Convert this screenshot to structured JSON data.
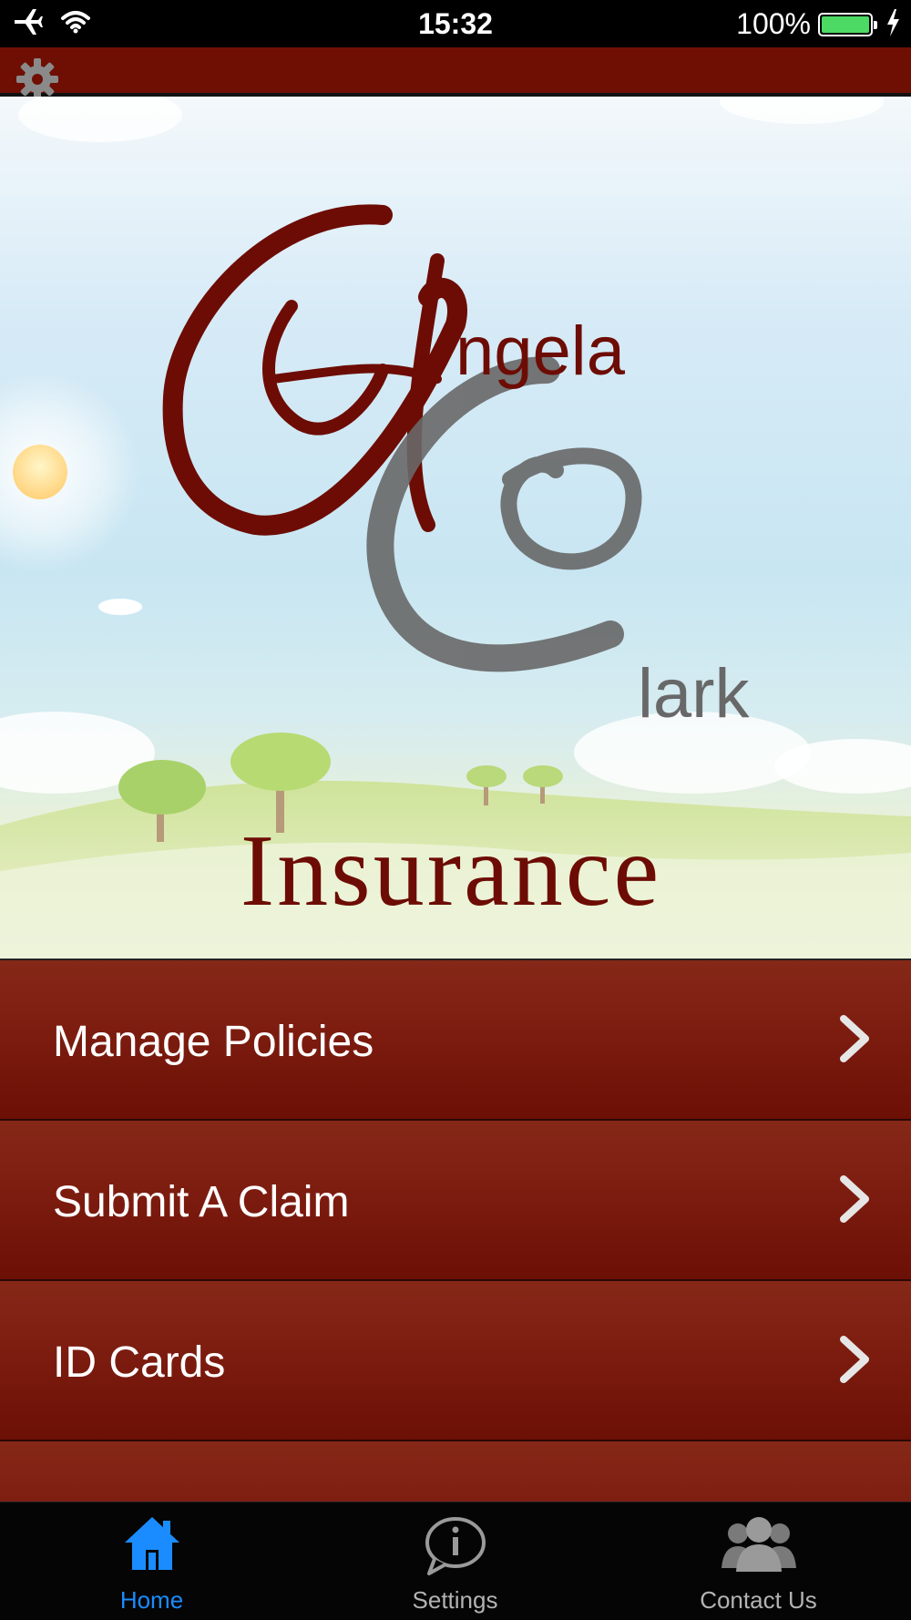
{
  "status_bar": {
    "time": "15:32",
    "battery_percent": "100%",
    "icons": [
      "airplane-icon",
      "wifi-icon",
      "battery-icon",
      "charging-bolt-icon"
    ]
  },
  "header": {
    "icon": "gear-icon",
    "color": "#6f0f04"
  },
  "hero": {
    "logo": {
      "line1": "ngela",
      "line2": "lark",
      "line3": "Insurance"
    },
    "colors": {
      "brand_red": "#6d0c04",
      "brand_gray": "#686868"
    }
  },
  "menu": {
    "items": [
      {
        "label": "Manage Policies",
        "icon": "chevron-right-icon"
      },
      {
        "label": "Submit A Claim",
        "icon": "chevron-right-icon"
      },
      {
        "label": "ID Cards",
        "icon": "chevron-right-icon"
      },
      {
        "label": "",
        "icon": "chevron-right-icon"
      }
    ]
  },
  "tab_bar": {
    "tabs": [
      {
        "label": "Home",
        "icon": "home-icon",
        "active": true
      },
      {
        "label": "Settings",
        "icon": "info-bubble-icon",
        "active": false
      },
      {
        "label": "Contact Us",
        "icon": "people-icon",
        "active": false
      }
    ],
    "active_color": "#1a8cff"
  }
}
